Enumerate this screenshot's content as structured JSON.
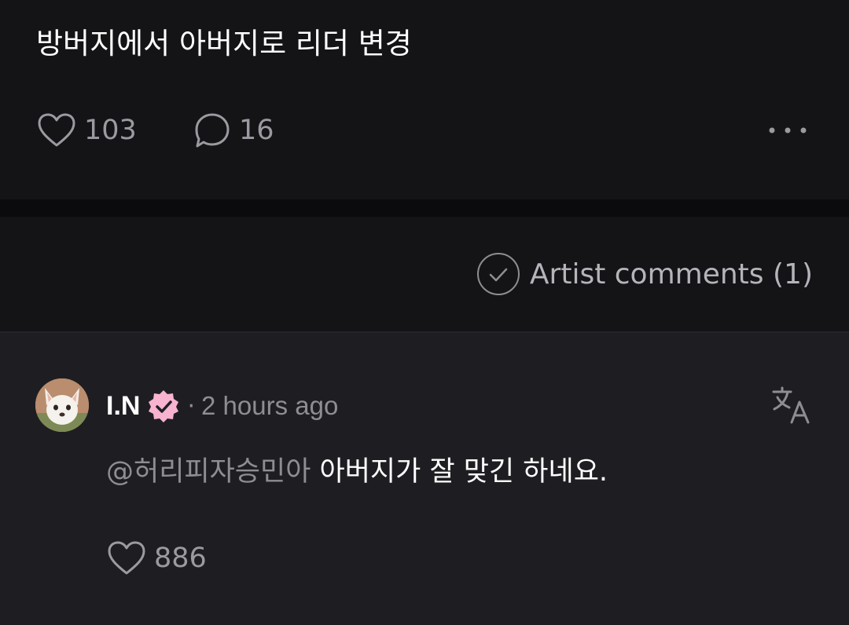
{
  "post": {
    "text": "방버지에서 아버지로 리더 변경",
    "like_count": "103",
    "comment_count": "16"
  },
  "filter": {
    "artist_comments_label": "Artist comments (1)"
  },
  "comment": {
    "author": "I.N",
    "separator": "·",
    "time": "2 hours ago",
    "mention": "@허리피자승민아",
    "text": " 아버지가 잘 맞긴 하네요.",
    "like_count": "886"
  },
  "colors": {
    "background": "#141417",
    "comment_background": "#1e1e22",
    "verified_badge": "#f7b3cf",
    "muted_text": "#8d8d93"
  },
  "icons": {
    "like": "heart-icon",
    "comment": "speech-bubble-icon",
    "more": "more-dots-icon",
    "artist_filter": "check-circle-icon",
    "verified": "verified-badge-icon",
    "translate": "translate-icon"
  }
}
